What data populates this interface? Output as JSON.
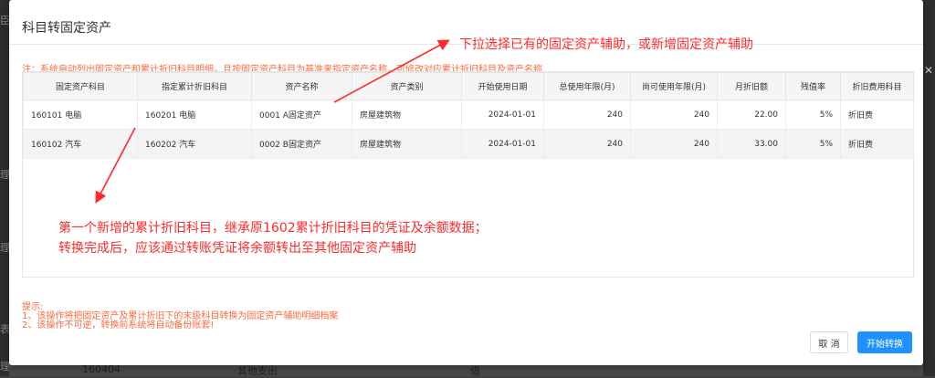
{
  "background": {
    "left_chars": [
      "臣",
      "理",
      "理",
      "表",
      "理"
    ],
    "bottom_row": [
      "160404",
      "其他支出",
      "借"
    ]
  },
  "modal": {
    "title": "科目转固定资产",
    "notice": "注：系统自动列出固定资产和累计折旧科目明细，且按固定资产科目为基准来指定资产名称，可修改对应累计折旧科目及资产名称",
    "columns": [
      "固定资产科目",
      "指定累计折旧科目",
      "资产名称",
      "资产类别",
      "开始使用日期",
      "总使用年限(月)",
      "尚可使用年限(月)",
      "月折旧额",
      "残值率",
      "折旧费用科目"
    ],
    "rows": [
      [
        "160101 电脑",
        "160201 电脑",
        "0001 A固定资产",
        "房屋建筑物",
        "2024-01-01",
        "240",
        "240",
        "22.00",
        "5%",
        "折旧费"
      ],
      [
        "160102 汽车",
        "160202 汽车",
        "0002 B固定资产",
        "房屋建筑物",
        "2024-01-01",
        "240",
        "240",
        "33.00",
        "5%",
        "折旧费"
      ]
    ],
    "hint": {
      "title": "提示:",
      "lines": [
        "1、该操作将把固定资产及累计折旧下的末级科目转换为固定资产辅助明细档案",
        "2、该操作不可逆，转换前系统将自动备份账套!"
      ]
    },
    "buttons": {
      "cancel": "取 消",
      "start": "开始转换"
    }
  },
  "annotations": {
    "top": "下拉选择已有的固定资产辅助，或新增固定资产辅助",
    "middle_line1": "第一个新增的累计折旧科目，继承原1602累计折旧科目的凭证及余额数据；",
    "middle_line2": "转换完成后，应该通过转账凭证将余额转出至其他固定资产辅助"
  },
  "colors": {
    "primary": "#1e90ff",
    "notice": "#ff6a3d",
    "annotation": "#ff2a2a"
  }
}
